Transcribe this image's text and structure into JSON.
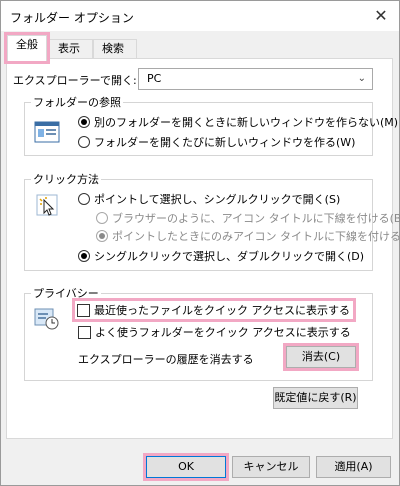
{
  "window": {
    "title": "フォルダー オプション",
    "close_glyph": "✕"
  },
  "tabs": [
    {
      "label": "全般"
    },
    {
      "label": "表示"
    },
    {
      "label": "検索"
    }
  ],
  "open_explorer": {
    "label": "エクスプローラーで開く:",
    "value": "PC"
  },
  "folder_browse": {
    "legend": "フォルダーの参照",
    "options": [
      {
        "label": "別のフォルダーを開くときに新しいウィンドウを作らない(M)"
      },
      {
        "label": "フォルダーを開くたびに新しいウィンドウを作る(W)"
      }
    ]
  },
  "click_method": {
    "legend": "クリック方法",
    "options": [
      {
        "label": "ポイントして選択し、シングルクリックで開く(S)"
      },
      {
        "label": "ブラウザーのように、アイコン タイトルに下線を付ける(B)"
      },
      {
        "label": "ポイントしたときにのみアイコン タイトルに下線を付ける(P)"
      },
      {
        "label": "シングルクリックで選択し、ダブルクリックで開く(D)"
      }
    ]
  },
  "privacy": {
    "legend": "プライバシー",
    "show_recent_files": "最近使ったファイルをクイック アクセスに表示する",
    "show_frequent_folders": "よく使うフォルダーをクイック アクセスに表示する",
    "clear_history_label": "エクスプローラーの履歴を消去する",
    "clear_button": "消去(C)"
  },
  "restore_defaults_button": "既定値に戻す(R)",
  "footer": {
    "ok": "OK",
    "cancel": "キャンセル",
    "apply": "適用(A)"
  },
  "colors": {
    "highlight": "#f2a8c4",
    "focus_border": "#0078d7"
  }
}
